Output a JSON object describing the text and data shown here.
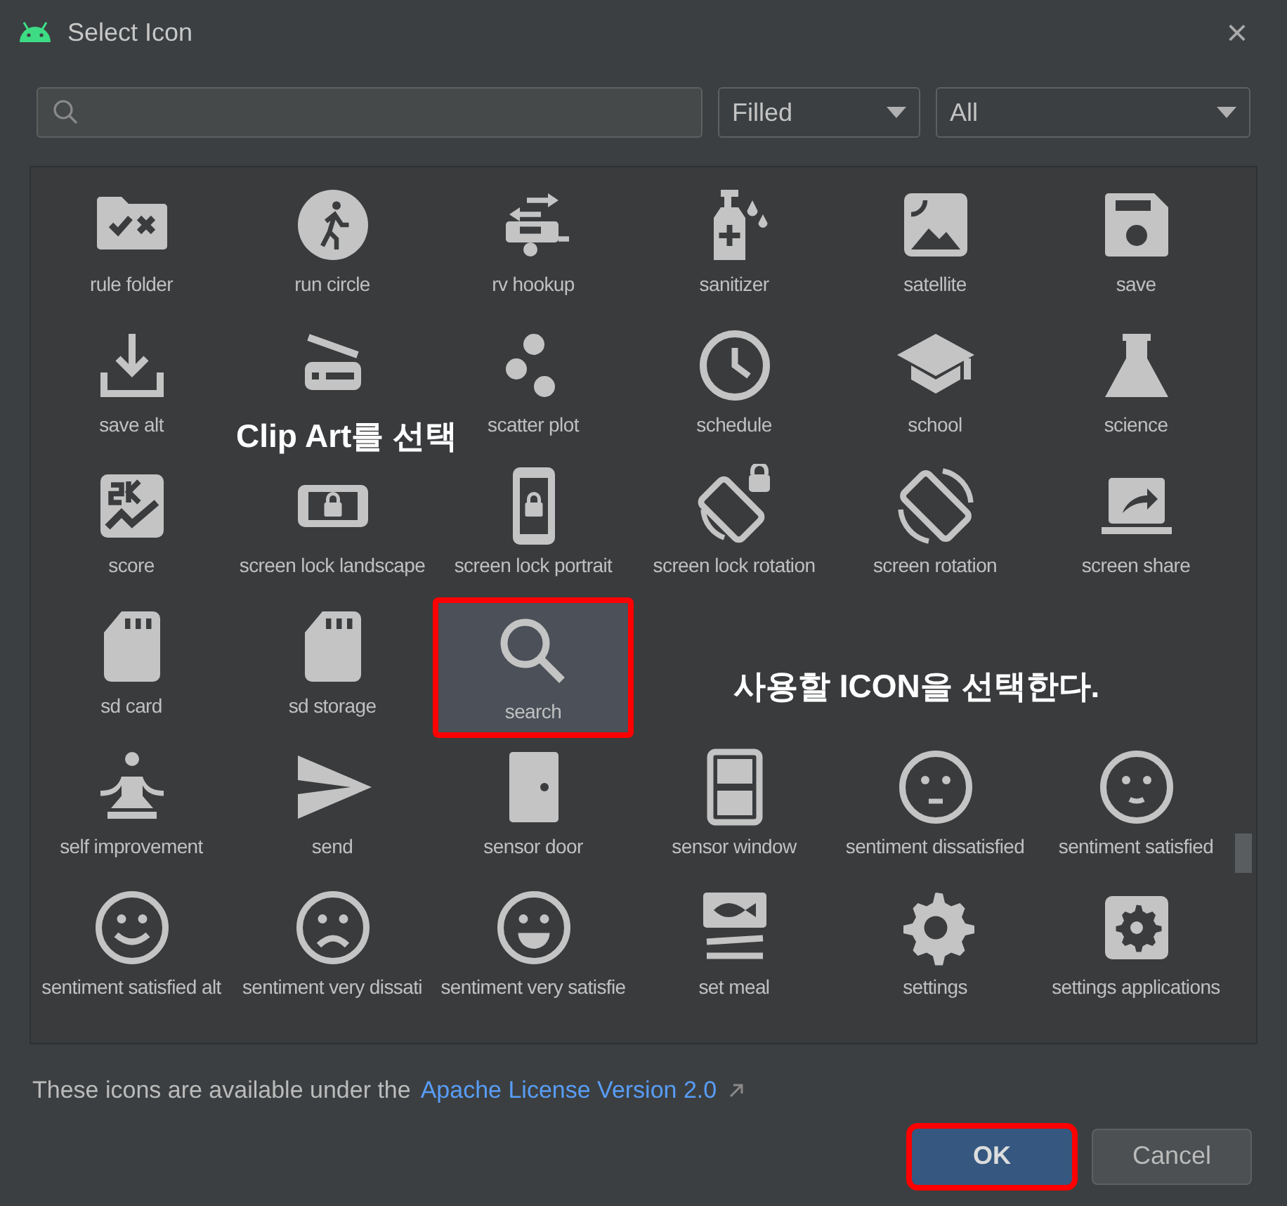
{
  "window": {
    "title": "Select Icon",
    "close": "×"
  },
  "dropdowns": [
    {
      "value": "Filled"
    },
    {
      "value": "All"
    }
  ],
  "grid": {
    "rows": [
      [
        {
          "label": "rule folder",
          "selected": false,
          "highlighted": false
        },
        {
          "label": "run circle",
          "selected": false,
          "highlighted": false
        },
        {
          "label": "rv hookup",
          "selected": false,
          "highlighted": false
        },
        {
          "label": "sanitizer",
          "selected": false,
          "highlighted": false
        },
        {
          "label": "satellite",
          "selected": false,
          "highlighted": false
        },
        {
          "label": "save",
          "selected": false,
          "highlighted": false
        }
      ],
      [
        {
          "label": "save alt",
          "selected": false,
          "highlighted": false
        },
        {
          "selected": false,
          "highlighted": false
        },
        {
          "label": "scatter plot",
          "selected": false,
          "highlighted": false
        },
        {
          "label": "schedule",
          "selected": false,
          "highlighted": false
        },
        {
          "label": "school",
          "selected": false,
          "highlighted": false
        },
        {
          "label": "science",
          "selected": false,
          "highlighted": false
        }
      ],
      [
        {
          "label": "score",
          "selected": false,
          "highlighted": false
        },
        {
          "label": "screen lock landscape",
          "selected": false,
          "highlighted": false
        },
        {
          "label": "screen lock portrait",
          "selected": false,
          "highlighted": false
        },
        {
          "label": "screen lock rotation",
          "selected": false,
          "highlighted": false
        },
        {
          "label": "screen rotation",
          "selected": false,
          "highlighted": false
        },
        {
          "label": "screen share",
          "selected": false,
          "highlighted": false
        }
      ],
      [
        {
          "label": "sd card",
          "selected": false,
          "highlighted": false
        },
        {
          "label": "sd storage",
          "selected": false,
          "highlighted": false
        },
        {
          "label": "search",
          "selected": true,
          "highlighted": true
        }
      ],
      [
        {
          "label": "self improvement",
          "selected": false,
          "highlighted": false
        },
        {
          "label": "send",
          "selected": false,
          "highlighted": false
        },
        {
          "label": "sensor door",
          "selected": false,
          "highlighted": false
        },
        {
          "label": "sensor window",
          "selected": false,
          "highlighted": false
        },
        {
          "label": "sentiment dissatisfied",
          "selected": false,
          "highlighted": false
        },
        {
          "label": "sentiment satisfied",
          "selected": false,
          "highlighted": false
        }
      ],
      [
        {
          "label": "sentiment satisfied alt",
          "selected": false,
          "highlighted": false
        },
        {
          "label": "sentiment very dissati",
          "selected": false,
          "highlighted": false
        },
        {
          "label": "sentiment very satisfie",
          "selected": false,
          "highlighted": false
        },
        {
          "label": "set meal",
          "selected": false,
          "highlighted": false
        },
        {
          "label": "settings",
          "selected": false,
          "highlighted": false
        },
        {
          "label": "settings applications",
          "selected": false,
          "highlighted": false
        }
      ]
    ]
  },
  "annotations": [
    {
      "text": "Clip Art를 선택"
    },
    {
      "text": "사용할 ICON을 선택한다."
    }
  ],
  "footer": {
    "text": "These icons are available under the",
    "link": "Apache License Version 2.0"
  },
  "buttons": [
    {
      "label": "OK",
      "primary": true,
      "highlighted": true
    },
    {
      "label": "Cancel",
      "primary": false,
      "highlighted": false
    }
  ]
}
